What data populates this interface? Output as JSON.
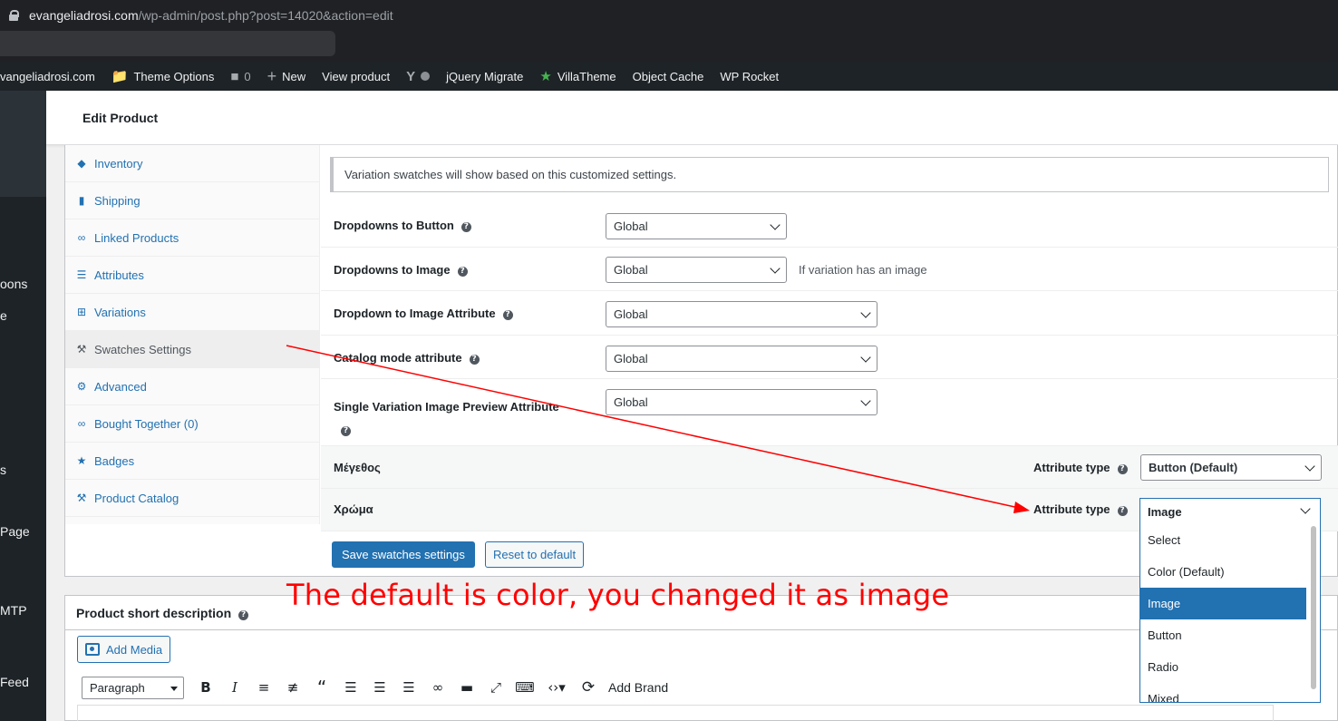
{
  "browser": {
    "url_host": "evangeliadrosi.com",
    "url_path": "/wp-admin/post.php?post=14020&action=edit"
  },
  "adminbar": {
    "site": "vangeliadrosi.com",
    "theme_options": "Theme Options",
    "comments_count": "0",
    "new": "New",
    "view_product": "View product",
    "jquery_migrate": "jQuery Migrate",
    "villatheme": "VillaTheme",
    "object_cache": "Object Cache",
    "wp_rocket": "WP Rocket"
  },
  "adminmenu_fragments": [
    "oons",
    "e",
    "s",
    "Page",
    "MTP",
    "Feed"
  ],
  "header": {
    "title": "Edit Product"
  },
  "tabs": [
    {
      "label": "Inventory",
      "icon": "tag-icon"
    },
    {
      "label": "Shipping",
      "icon": "truck-icon"
    },
    {
      "label": "Linked Products",
      "icon": "link-icon"
    },
    {
      "label": "Attributes",
      "icon": "list-icon"
    },
    {
      "label": "Variations",
      "icon": "grid-icon"
    },
    {
      "label": "Swatches Settings",
      "icon": "wrench-icon",
      "active": true
    },
    {
      "label": "Advanced",
      "icon": "gear-icon"
    },
    {
      "label": "Bought Together  (0)",
      "icon": "link-icon"
    },
    {
      "label": "Badges",
      "icon": "badge-icon"
    },
    {
      "label": "Product Catalog",
      "icon": "wrench-icon"
    }
  ],
  "swatches": {
    "notice": "Variation swatches will show based on this customized settings.",
    "settings": [
      {
        "label": "Dropdowns to Button",
        "value": "Global"
      },
      {
        "label": "Dropdowns to Image",
        "value": "Global",
        "hint": "If variation has an image"
      },
      {
        "label": "Dropdown to Image Attribute",
        "value": "Global"
      },
      {
        "label": "Catalog mode attribute",
        "value": "Global"
      },
      {
        "label": "Single Variation Image Preview Attribute",
        "value": "Global"
      }
    ],
    "attributes": [
      {
        "name": "Μέγεθος",
        "type_label": "Attribute type",
        "value": "Button (Default)"
      },
      {
        "name": "Χρώμα",
        "type_label": "Attribute type",
        "value": "Image"
      }
    ],
    "dropdown_options": [
      "Select",
      "Color (Default)",
      "Image",
      "Button",
      "Radio",
      "Mixed"
    ],
    "dropdown_selected": "Image",
    "save_button": "Save swatches settings",
    "reset_button": "Reset to default"
  },
  "short_description": {
    "title": "Product short description",
    "add_media": "Add Media",
    "format": "Paragraph",
    "add_brand": "Add Brand"
  },
  "annotation": {
    "text": "The default is color, you changed it as image",
    "color": "#ff0000"
  },
  "colors": {
    "accent": "#2271b1",
    "adminbar": "#1d2327"
  }
}
